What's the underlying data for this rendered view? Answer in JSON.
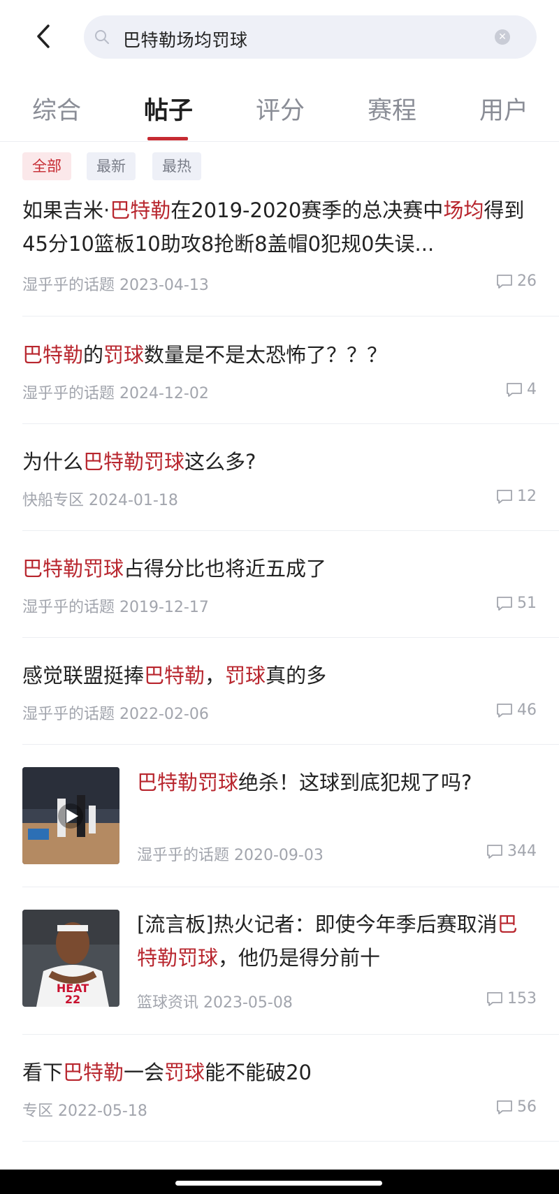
{
  "search": {
    "query": "巴特勒场均罚球"
  },
  "tabs": [
    "综合",
    "帖子",
    "评分",
    "赛程",
    "用户"
  ],
  "filters": [
    "全部",
    "最新",
    "最热"
  ],
  "posts": [
    {
      "title_parts": [
        {
          "t": "如果吉米·",
          "hl": false
        },
        {
          "t": "巴特勒",
          "hl": true
        },
        {
          "t": "在2019-2020赛季的总决赛中",
          "hl": false
        },
        {
          "t": "场均",
          "hl": true
        },
        {
          "t": "得到45分10篮板10助攻8抢断8盖帽0犯规0失误...",
          "hl": false
        }
      ],
      "source": "湿乎乎的话题",
      "date": "2023-04-13",
      "comments": "26"
    },
    {
      "title_parts": [
        {
          "t": "巴特勒",
          "hl": true
        },
        {
          "t": "的",
          "hl": false
        },
        {
          "t": "罚球",
          "hl": true
        },
        {
          "t": "数量是不是太恐怖了？？？",
          "hl": false
        }
      ],
      "source": "湿乎乎的话题",
      "date": "2024-12-02",
      "comments": "4"
    },
    {
      "title_parts": [
        {
          "t": "为什么",
          "hl": false
        },
        {
          "t": "巴特勒罚球",
          "hl": true
        },
        {
          "t": "这么多?",
          "hl": false
        }
      ],
      "source": "快船专区",
      "date": "2024-01-18",
      "comments": "12"
    },
    {
      "title_parts": [
        {
          "t": "巴特勒罚球",
          "hl": true
        },
        {
          "t": "占得分比也将近五成了",
          "hl": false
        }
      ],
      "source": "湿乎乎的话题",
      "date": "2019-12-17",
      "comments": "51"
    },
    {
      "title_parts": [
        {
          "t": "感觉联盟挺捧",
          "hl": false
        },
        {
          "t": "巴特勒",
          "hl": true
        },
        {
          "t": "，",
          "hl": false
        },
        {
          "t": "罚球",
          "hl": true
        },
        {
          "t": "真的多",
          "hl": false
        }
      ],
      "source": "湿乎乎的话题",
      "date": "2022-02-06",
      "comments": "46"
    },
    {
      "title_parts": [
        {
          "t": "巴特勒罚球",
          "hl": true
        },
        {
          "t": "绝杀！这球到底犯规了吗?",
          "hl": false
        }
      ],
      "source": "湿乎乎的话题",
      "date": "2020-09-03",
      "comments": "344"
    },
    {
      "title_parts": [
        {
          "t": "[流言板]热火记者：即使今年季后赛取消",
          "hl": false
        },
        {
          "t": "巴特勒罚球",
          "hl": true
        },
        {
          "t": "，他仍是得分前十",
          "hl": false
        }
      ],
      "source": "篮球资讯",
      "date": "2023-05-08",
      "comments": "153"
    },
    {
      "title_parts": [
        {
          "t": "看下",
          "hl": false
        },
        {
          "t": "巴特勒",
          "hl": true
        },
        {
          "t": "一会",
          "hl": false
        },
        {
          "t": "罚球",
          "hl": true
        },
        {
          "t": "能不能破20",
          "hl": false
        }
      ],
      "source": "专区",
      "date": "2022-05-18",
      "comments": "56"
    }
  ]
}
